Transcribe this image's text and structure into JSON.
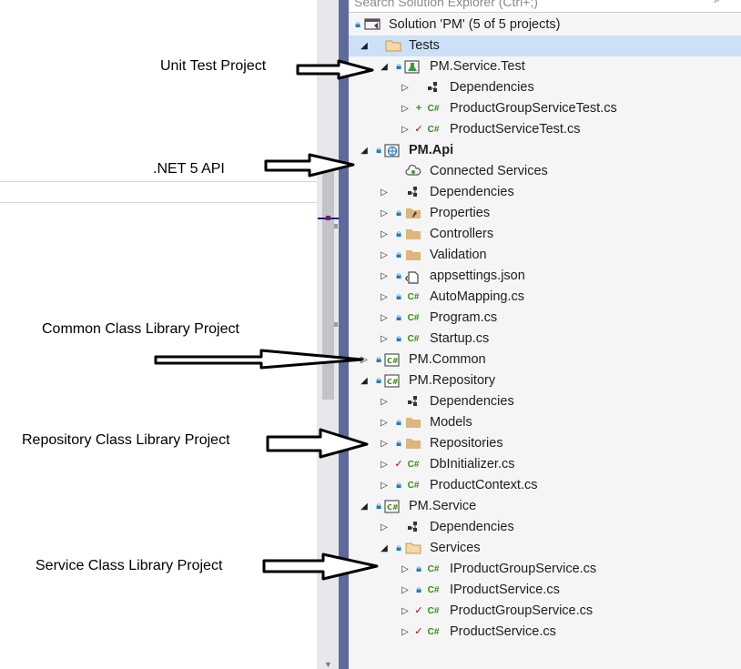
{
  "annotations": {
    "unit_test": "Unit Test Project",
    "net5_api": ".NET 5 API",
    "common_lib": "Common Class Library Project",
    "repository_lib": "Repository Class Library Project",
    "service_lib": "Service Class Library Project"
  },
  "solution_explorer": {
    "search_placeholder": "Search Solution Explorer (Ctrl+;)",
    "items": [
      {
        "label": "Solution 'PM' (5 of 5 projects)"
      },
      {
        "label": "Tests"
      },
      {
        "label": "PM.Service.Test"
      },
      {
        "label": "Dependencies"
      },
      {
        "label": "ProductGroupServiceTest.cs"
      },
      {
        "label": "ProductServiceTest.cs"
      },
      {
        "label": "PM.Api"
      },
      {
        "label": "Connected Services"
      },
      {
        "label": "Dependencies"
      },
      {
        "label": "Properties"
      },
      {
        "label": "Controllers"
      },
      {
        "label": "Validation"
      },
      {
        "label": "appsettings.json"
      },
      {
        "label": "AutoMapping.cs"
      },
      {
        "label": "Program.cs"
      },
      {
        "label": "Startup.cs"
      },
      {
        "label": "PM.Common"
      },
      {
        "label": "PM.Repository"
      },
      {
        "label": "Dependencies"
      },
      {
        "label": "Models"
      },
      {
        "label": "Repositories"
      },
      {
        "label": "DbInitializer.cs"
      },
      {
        "label": "ProductContext.cs"
      },
      {
        "label": "PM.Service"
      },
      {
        "label": "Dependencies"
      },
      {
        "label": "Services"
      },
      {
        "label": "IProductGroupService.cs"
      },
      {
        "label": "IProductService.cs"
      },
      {
        "label": "ProductGroupService.cs"
      },
      {
        "label": "ProductService.cs"
      }
    ]
  },
  "colors": {
    "splitter": "#5e6a9c",
    "selection": "#cce0f7",
    "panel_bg": "#f5f5f5",
    "csharp_icon": "#378a1a",
    "lock_icon": "#1c7cc9",
    "pending_check": "#c00000",
    "added_plus": "#2e8b2e",
    "folder": "#dcb67a"
  }
}
